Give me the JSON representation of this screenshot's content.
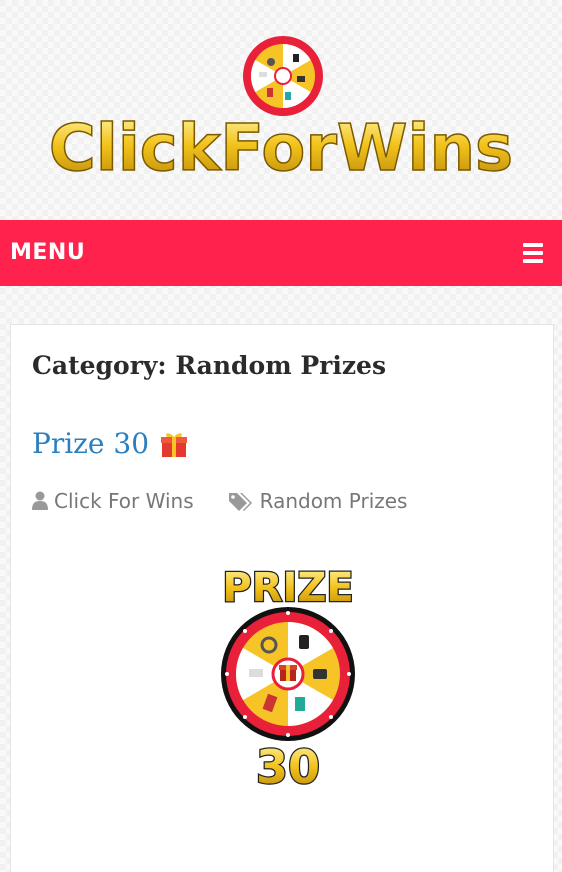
{
  "site": {
    "brand": "ClickForWins"
  },
  "menu": {
    "label": "MENU",
    "toggle_icon": "hamburger-icon"
  },
  "archive": {
    "category_title": "Category: Random Prizes"
  },
  "post": {
    "title": "Prize 30",
    "title_emoji": "gift-icon",
    "author": "Click For Wins",
    "category": "Random Prizes",
    "image": {
      "top_word": "PRIZE",
      "number": "30"
    }
  },
  "colors": {
    "menu_bar": "#ff224c",
    "link": "#2a7fc0",
    "logo_gold": "#f2c21b",
    "wheel_red": "#e8203a",
    "wheel_yellow": "#f7c427"
  }
}
